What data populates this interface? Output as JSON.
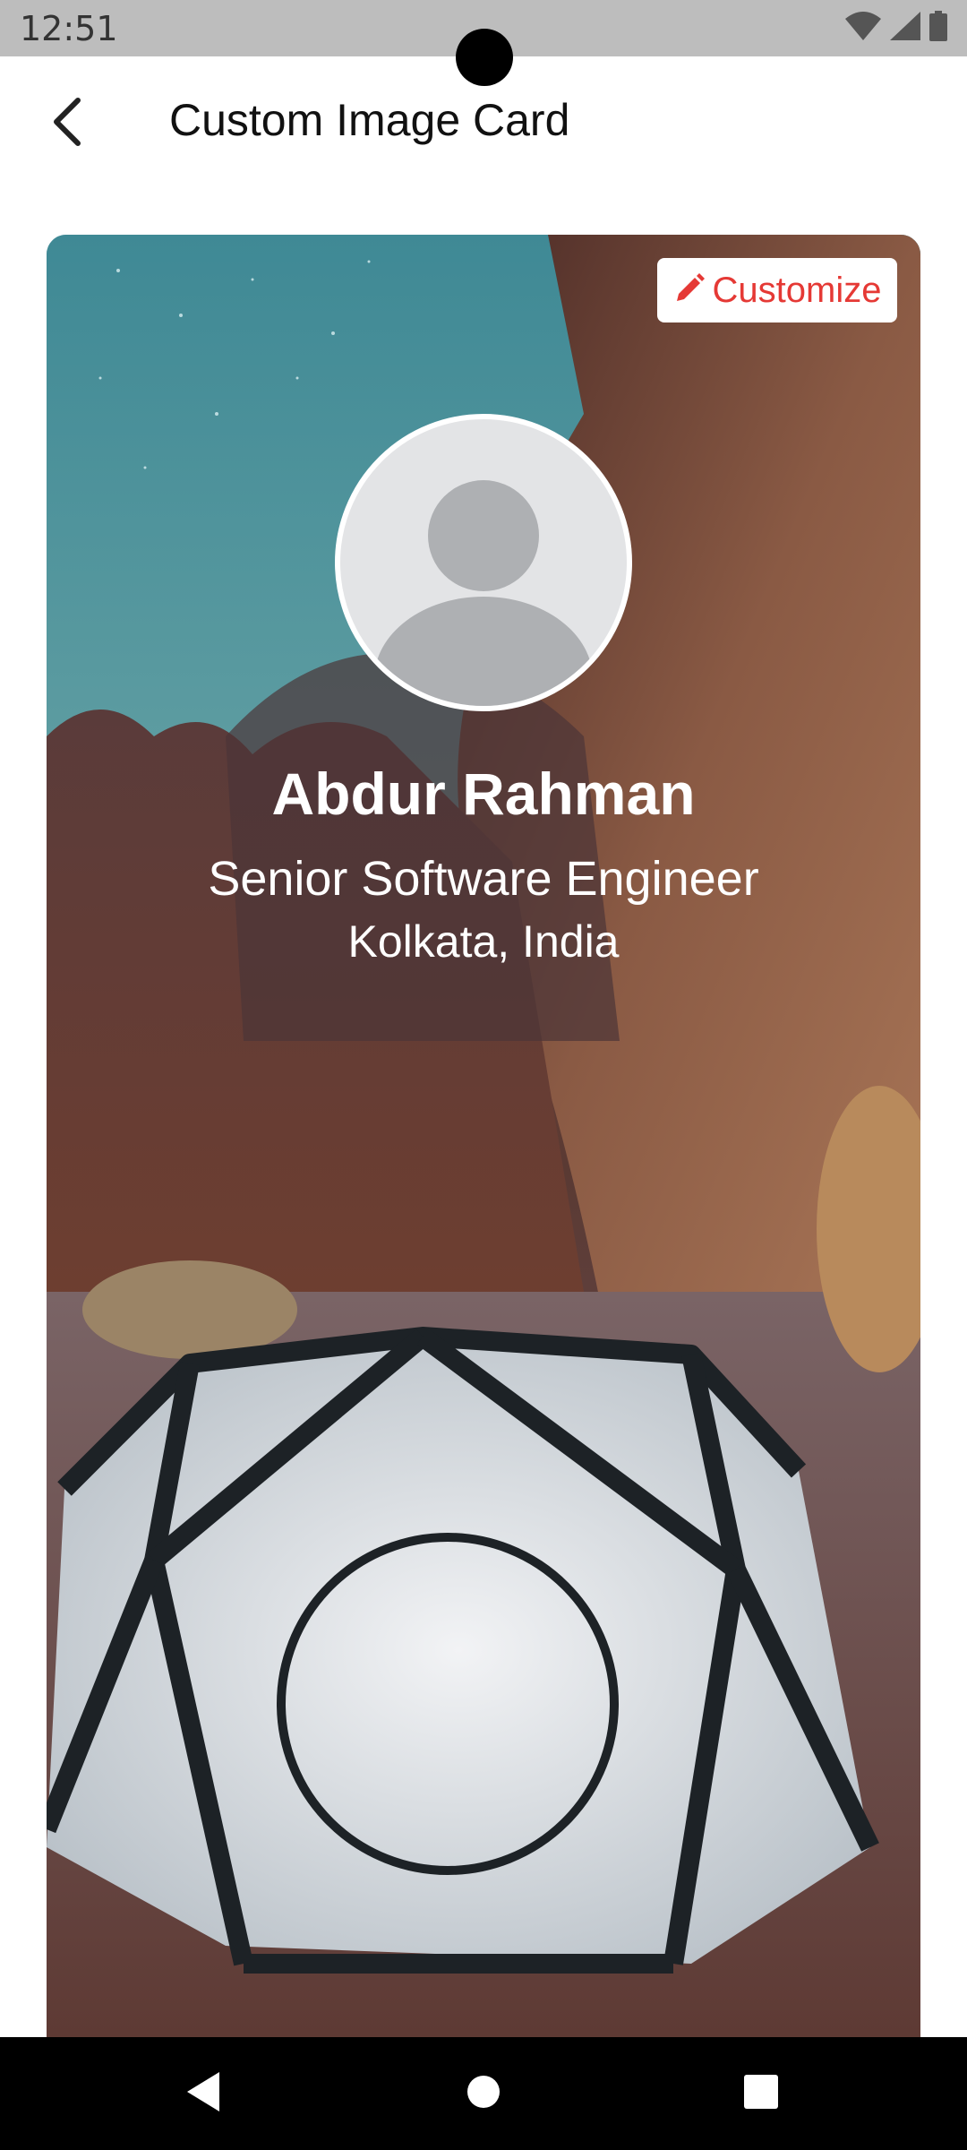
{
  "status_bar": {
    "time": "12:51",
    "icons": [
      "wifi-icon",
      "cell-signal-icon",
      "battery-icon"
    ]
  },
  "app_bar": {
    "title": "Custom Image Card",
    "back_icon": "back-arrow-icon"
  },
  "card": {
    "customize_label": "Customize",
    "customize_icon": "pencil-icon",
    "customize_color": "#e53935",
    "avatar_icon": "person-placeholder-icon",
    "name": "Abdur Rahman",
    "role": "Senior Software Engineer",
    "location": "Kolkata, India",
    "background_image": "desert-canyon-tent-photo"
  },
  "nav_bar": {
    "buttons": [
      "back-triangle-icon",
      "home-circle-icon",
      "recents-square-icon"
    ]
  }
}
